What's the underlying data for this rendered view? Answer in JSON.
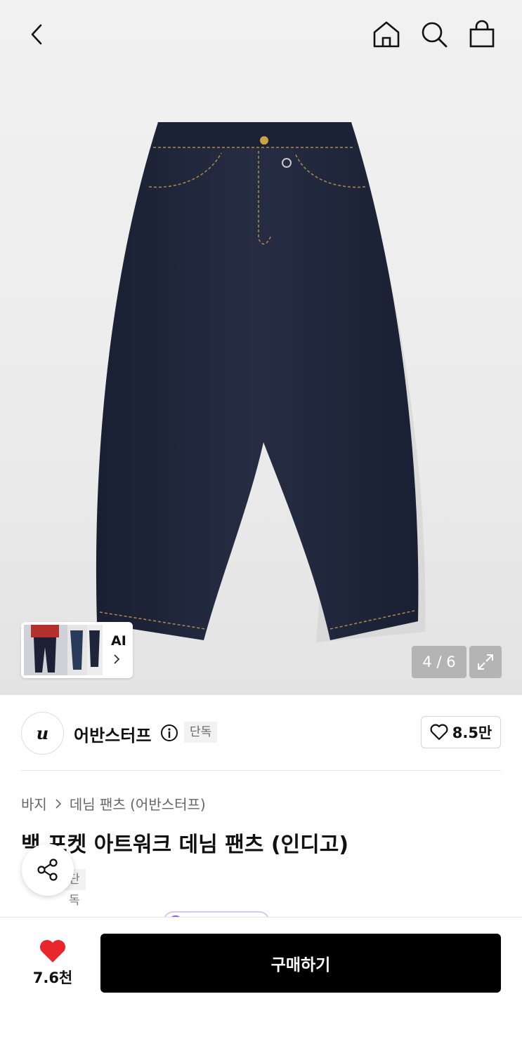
{
  "header": {
    "icons": [
      "back-icon",
      "home-icon",
      "search-icon",
      "shopping-bag-icon"
    ]
  },
  "gallery": {
    "ai_label": "AI",
    "counter": "4 / 6",
    "current": 4,
    "total": 6
  },
  "brand": {
    "logo_text": "u",
    "name": "어반스터프",
    "badge": "단독",
    "likes": "8.5만"
  },
  "breadcrumb": {
    "items": [
      "바지",
      "데님 팬츠 (어반스터프)"
    ]
  },
  "product": {
    "title": "백 포켓 아트워크 데님 팬츠 (인디고)",
    "tag": "단독"
  },
  "bottom": {
    "wish_count": "7.6천",
    "buy_label": "구매하기"
  },
  "colors": {
    "accent": "#000000",
    "heart": "#e8262b",
    "denim": "#1f2538"
  }
}
